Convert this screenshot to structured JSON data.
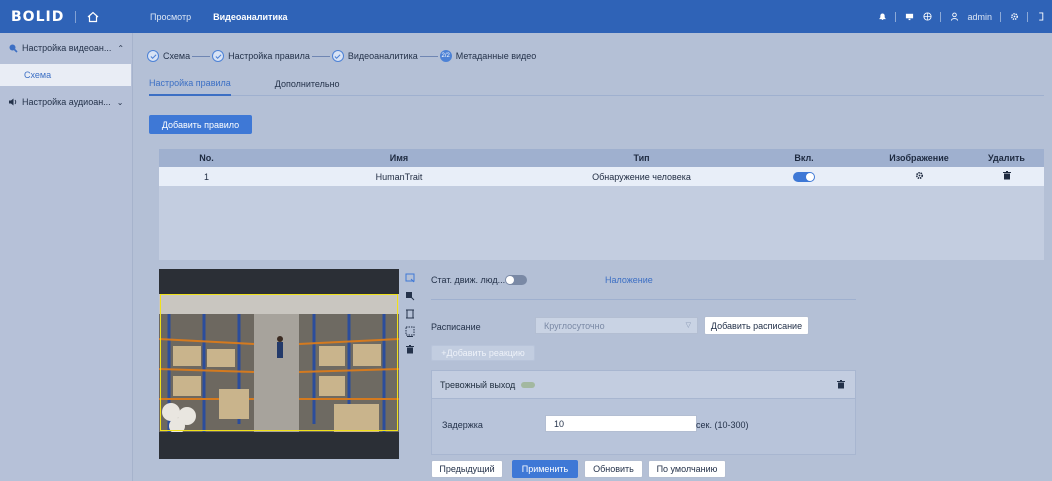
{
  "header": {
    "logo": "BOLID",
    "nav": [
      {
        "label": "Просмотр"
      },
      {
        "label": "Видеоаналитика"
      }
    ],
    "user": "admin"
  },
  "sidebar": {
    "groups": [
      {
        "label": "Настройка видеоан...",
        "expanded": true,
        "items": [
          {
            "label": "Схема",
            "active": true
          }
        ]
      },
      {
        "label": "Настройка аудиоан...",
        "expanded": false,
        "items": []
      }
    ]
  },
  "stepper": {
    "steps": [
      {
        "label": "Схема",
        "done": true
      },
      {
        "label": "Настройка правила",
        "done": true
      },
      {
        "label": "Видеоаналитика",
        "done": true
      },
      {
        "label": "Метаданные видео",
        "done": false,
        "badge": "2/2"
      }
    ]
  },
  "tabs": [
    {
      "label": "Настройка правила",
      "active": true
    },
    {
      "label": "Дополнительно",
      "active": false
    }
  ],
  "add_rule_button": "Добавить правило",
  "rules_table": {
    "columns": [
      "No.",
      "Имя",
      "Тип",
      "Вкл.",
      "Изображение",
      "Удалить"
    ],
    "rows": [
      {
        "no": "1",
        "name": "HumanTrait",
        "type": "Обнаружение человека",
        "enabled": true
      }
    ]
  },
  "config": {
    "stat_label": "Стат. движ. люд...",
    "stat_enabled": false,
    "overlay_link": "Наложение",
    "schedule_label": "Расписание",
    "schedule_value": "Круглосуточно",
    "add_schedule_button": "Добавить расписание",
    "add_reaction_button": "+Добавить реакцию",
    "alarm_output_label": "Тревожный выход",
    "delay_label": "Задержка",
    "delay_value": "10",
    "delay_unit": "сек. (10-300)"
  },
  "footer_buttons": {
    "prev": "Предыдущий",
    "apply": "Применить",
    "refresh": "Обновить",
    "default": "По умолчанию"
  },
  "colors": {
    "topbar": "#2f63b7",
    "accent": "#3e78d6",
    "background": "#b4c0d6"
  }
}
